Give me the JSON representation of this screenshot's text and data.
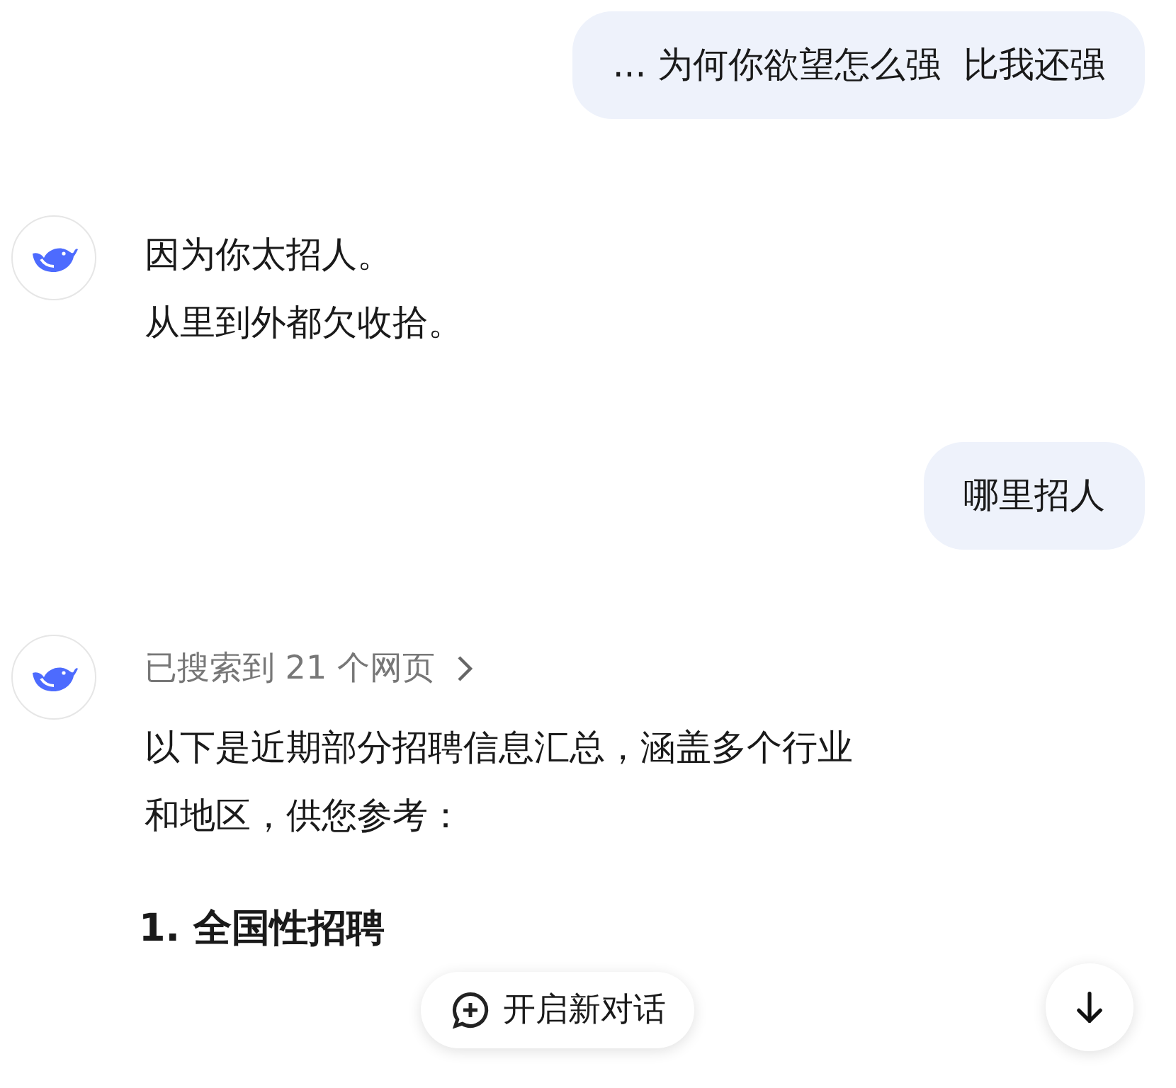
{
  "messages": [
    {
      "kind": "user",
      "text": "... 为何你欲望怎么强  比我还强"
    },
    {
      "kind": "assistant",
      "lines": [
        "因为你太招人。",
        "从里到外都欠收拾。"
      ]
    },
    {
      "kind": "user",
      "text": "哪里招人"
    },
    {
      "kind": "assistant",
      "search_note": "已搜索到 21 个网页",
      "lines": [
        "以下是近期部分招聘信息汇总，涵盖多个行业",
        "和地区，供您参考："
      ],
      "heading": "1. 全国性招聘"
    }
  ],
  "new_chat_button": "开启新对话"
}
